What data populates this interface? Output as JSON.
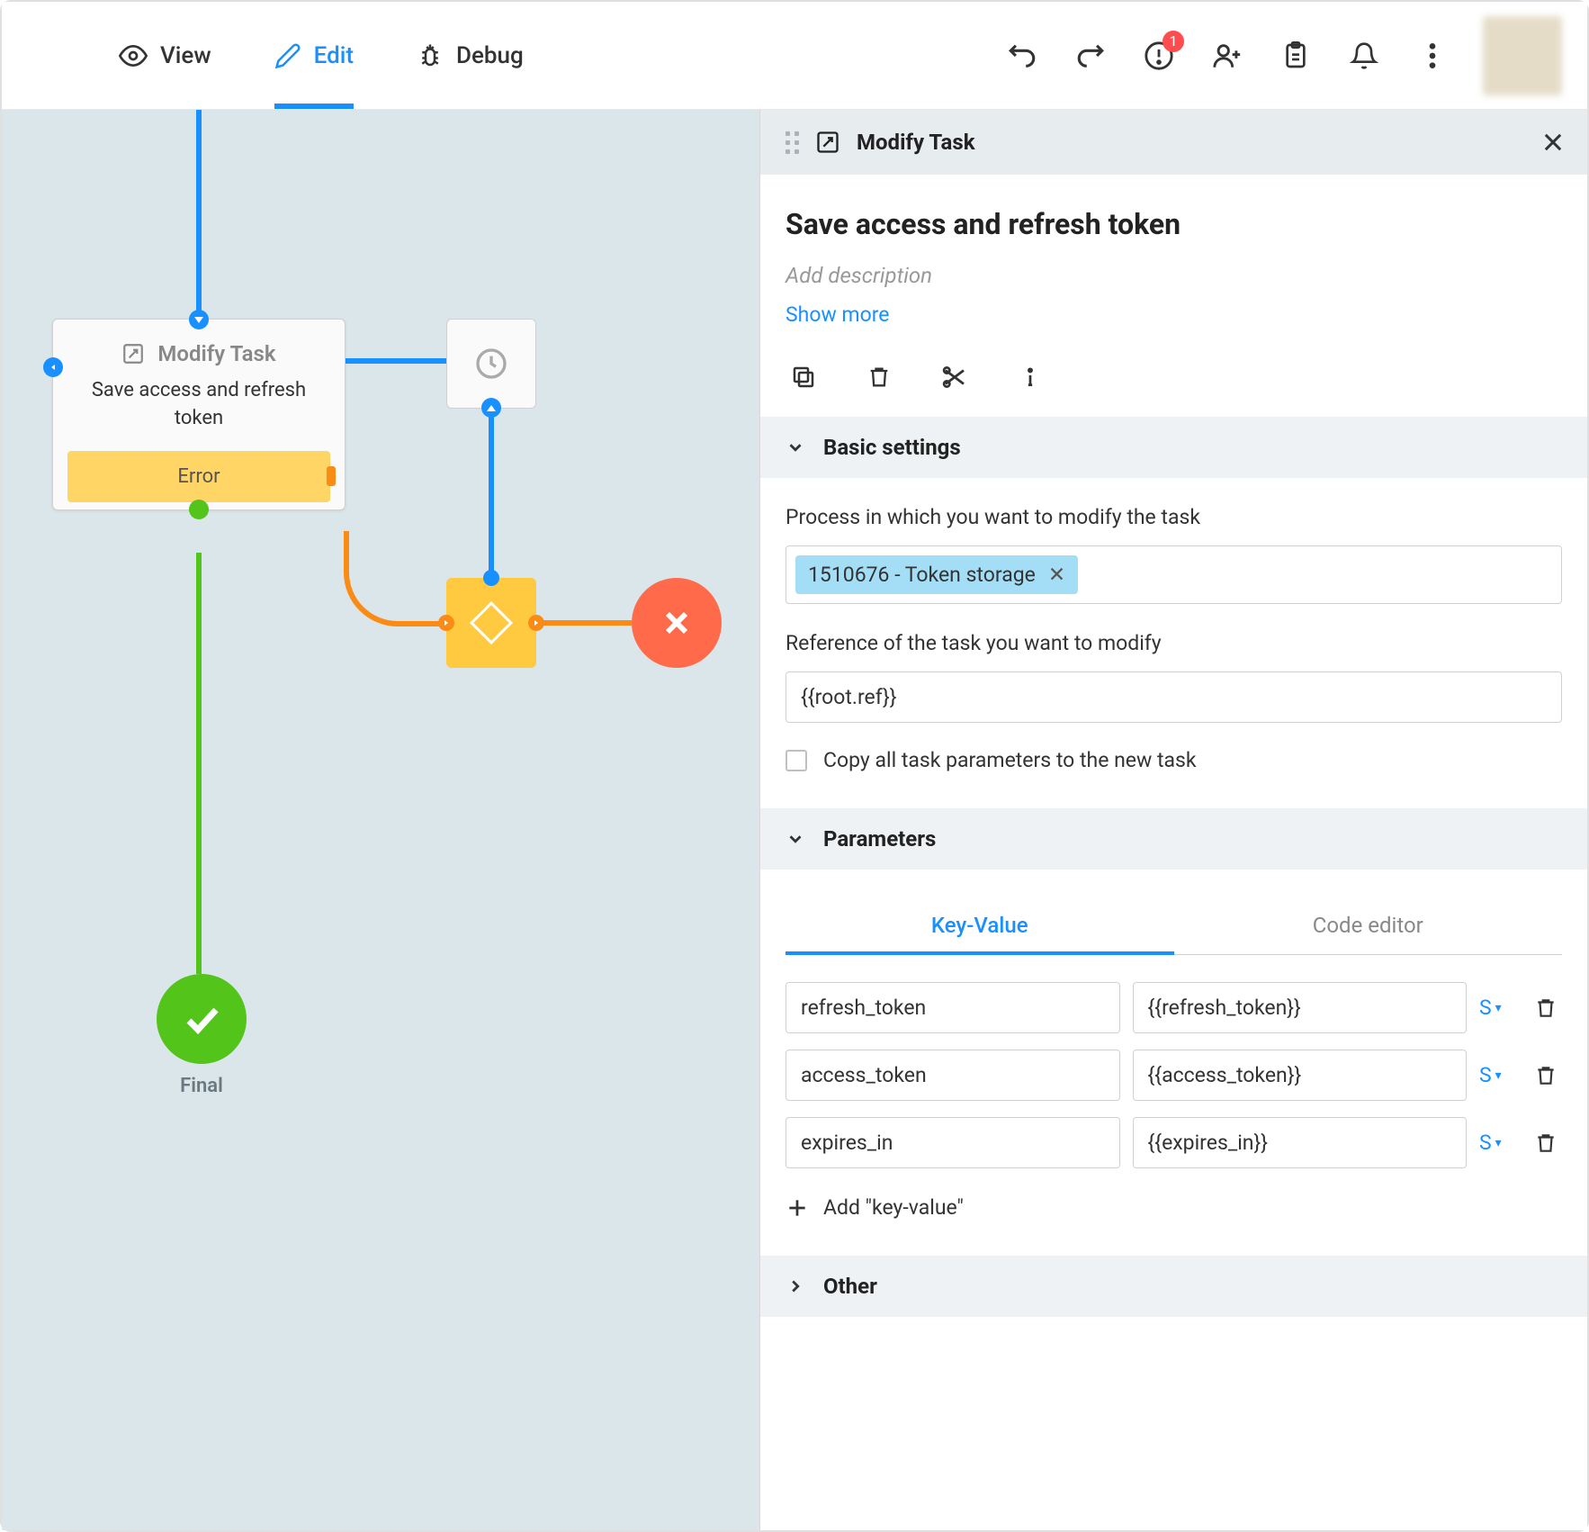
{
  "toolbar": {
    "tabs": {
      "view": "View",
      "edit": "Edit",
      "debug": "Debug"
    },
    "notification_count": "1"
  },
  "canvas": {
    "node_type": "Modify Task",
    "node_title": "Save access and refresh token",
    "error_label": "Error",
    "final_label": "Final"
  },
  "panel": {
    "header": "Modify Task",
    "title": "Save access and refresh token",
    "desc_placeholder": "Add description",
    "show_more": "Show more",
    "sections": {
      "basic": "Basic settings",
      "parameters": "Parameters",
      "other": "Other"
    },
    "basic": {
      "process_label": "Process in which you want to modify the task",
      "process_chip": "1510676 - Token storage",
      "ref_label": "Reference of the task you want to modify",
      "ref_value": "{{root.ref}}",
      "copy_label": "Copy all task parameters to the new task"
    },
    "parameters": {
      "tab_kv": "Key-Value",
      "tab_code": "Code editor",
      "rows": [
        {
          "key": "refresh_token",
          "value": "{{refresh_token}}",
          "type": "S"
        },
        {
          "key": "access_token",
          "value": "{{access_token}}",
          "type": "S"
        },
        {
          "key": "expires_in",
          "value": "{{expires_in}}",
          "type": "S"
        }
      ],
      "add_label": "Add \"key-value\""
    }
  }
}
